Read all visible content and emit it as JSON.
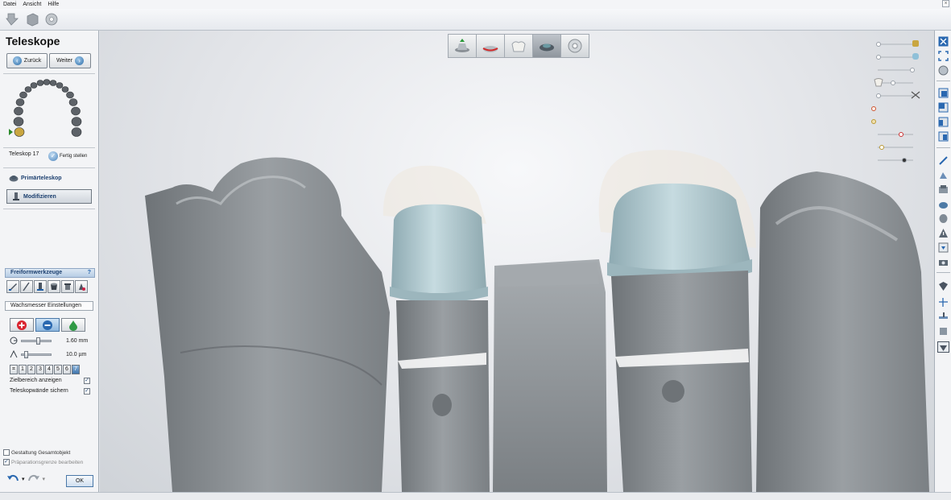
{
  "menu": {
    "items": [
      "Datei",
      "Ansicht",
      "Hilfe"
    ]
  },
  "panel": {
    "title": "Teleskope",
    "back_label": "Zurück",
    "next_label": "Weiter",
    "tooth_label": "Teleskop 17",
    "finish_label": "Fertig stellen",
    "primary_label": "Primärteleskop",
    "modify_label": "Modifizieren"
  },
  "freeform": {
    "title": "Freiformwerkzeuge",
    "help": "?",
    "tool_icons": [
      "knife-icon",
      "brush-icon",
      "wax-knife-icon",
      "cup-icon",
      "cap-icon",
      "hand-tool-icon"
    ]
  },
  "wax_settings": {
    "title": "Wachsmesser Einstellungen",
    "size_value": "1.60 mm",
    "depth_value": "10.0 µm",
    "size_fraction": 0.55,
    "depth_fraction": 0.1,
    "numbers": [
      "1",
      "2",
      "3",
      "4",
      "5",
      "6",
      "7"
    ],
    "selected_number": "7",
    "show_target_label": "Zielbereich anzeigen",
    "show_target_checked": true,
    "protect_walls_label": "Teleskopwände sichern",
    "protect_walls_checked": true
  },
  "bottom": {
    "overall_label": "Gestaltung Gesamtobjekt",
    "overall_checked": false,
    "prep_label": "Präparationsgrenze bearbeiten",
    "prep_checked": true,
    "ok_label": "OK"
  },
  "colors": {
    "accent": "#1a3e6e",
    "crown": "#a9c4cc",
    "stone": "#8d9296"
  }
}
